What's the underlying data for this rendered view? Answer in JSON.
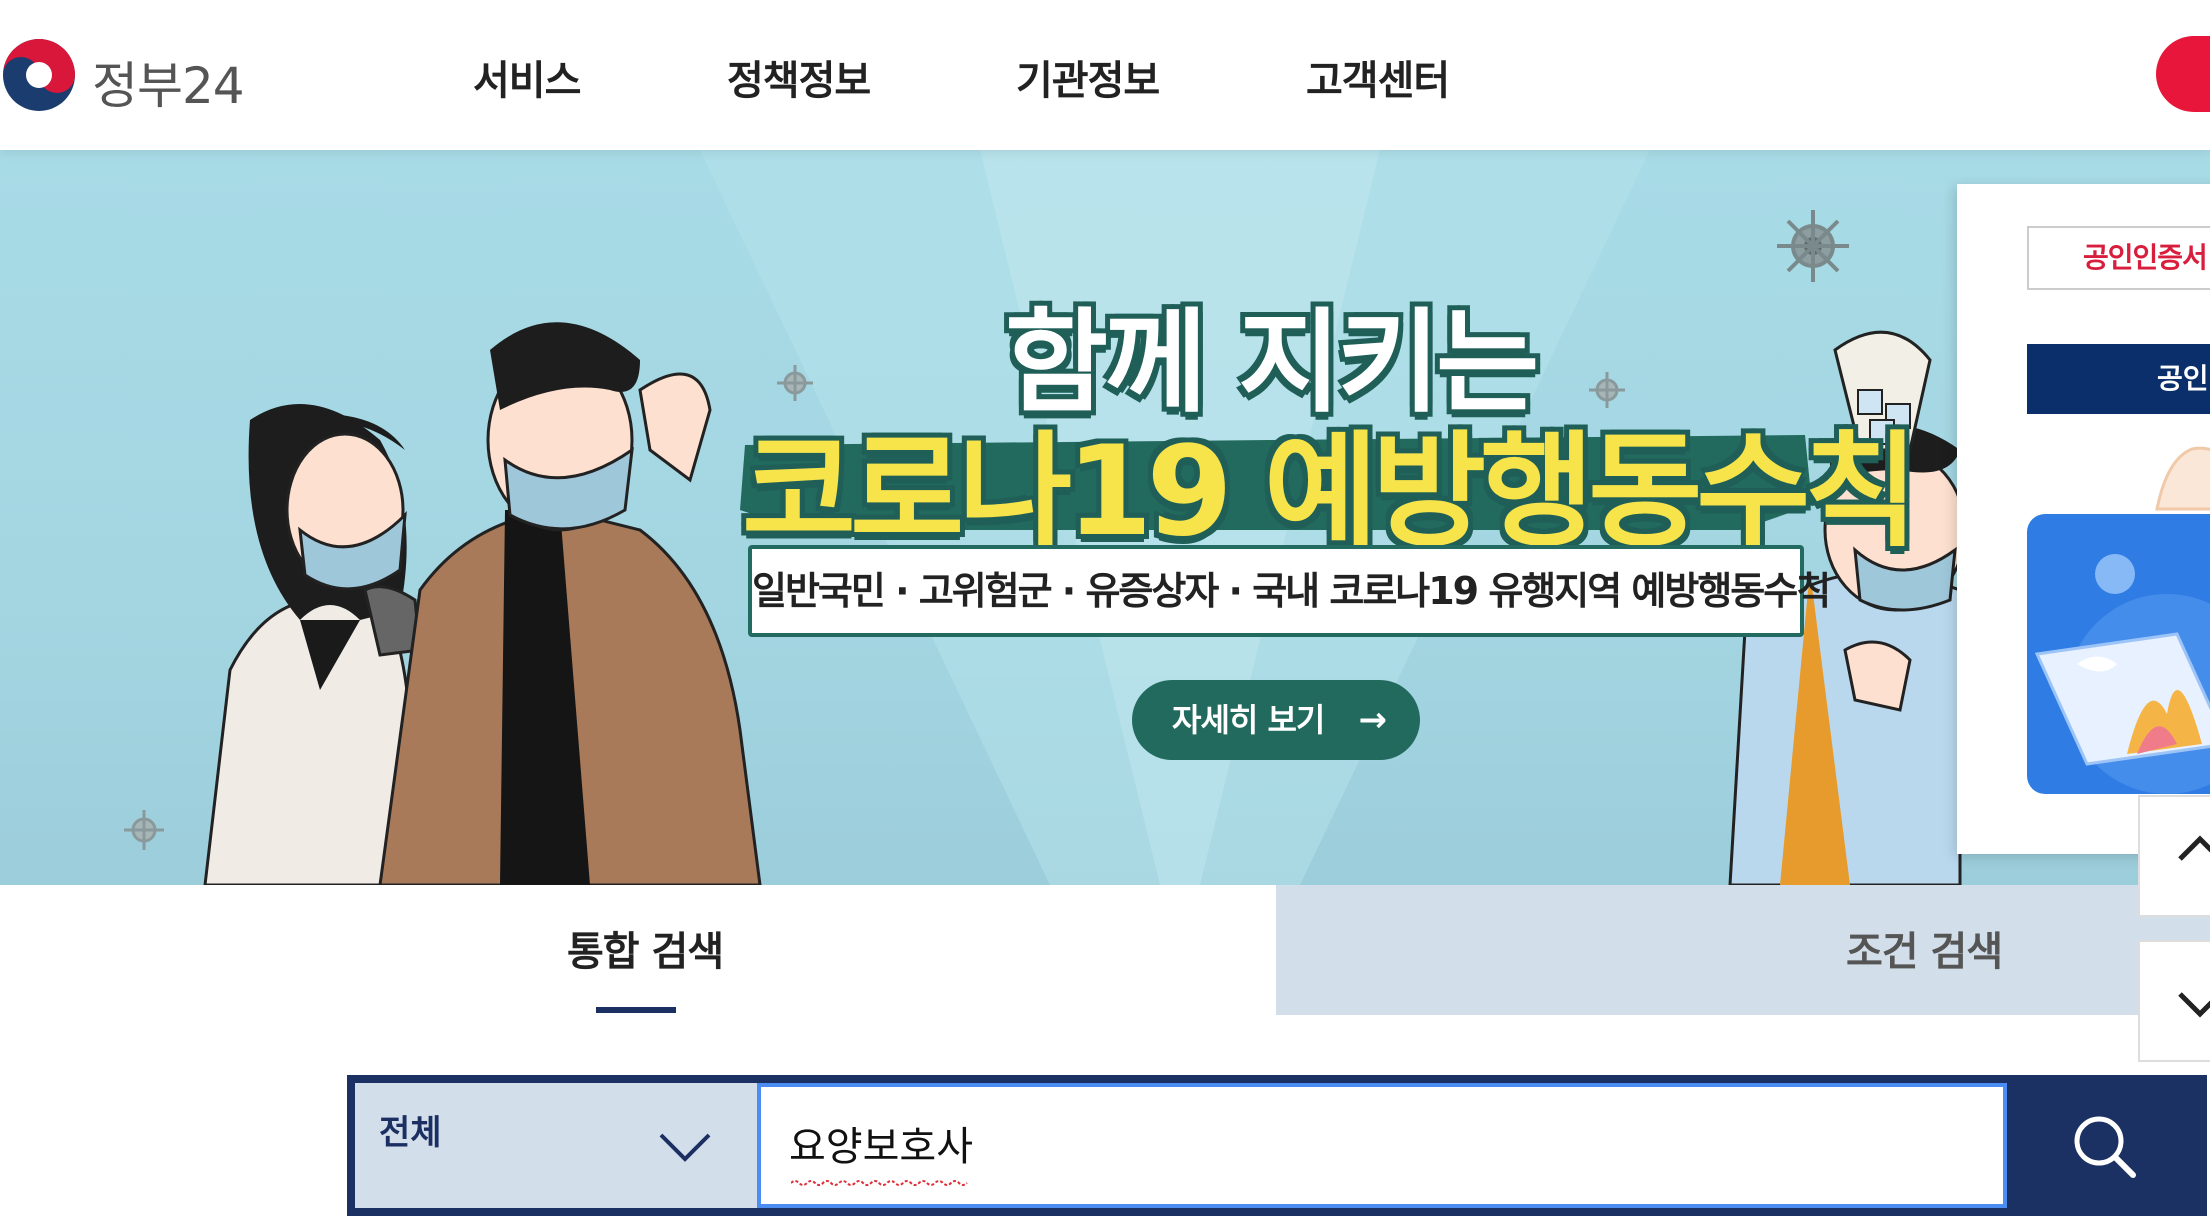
{
  "header": {
    "logo_text": "정부24",
    "nav": [
      "서비스",
      "정책정보",
      "기관정보",
      "고객센터"
    ]
  },
  "banner": {
    "title_line1": "함께 지키는",
    "title_line2": "코로나19 예방행동수칙",
    "subtitle": "일반국민 · 고위험군 · 유증상자 · 국내 코로나19 유행지역 예방행동수칙",
    "button_label": "자세히 보기",
    "button_arrow": "→"
  },
  "side_panel": {
    "cert_outline_label": "공인인증서",
    "cert_solid_label": "공인"
  },
  "search": {
    "tabs": [
      "통합 검색",
      "조건 검색"
    ],
    "active_tab": "통합 검색",
    "category_selected": "전체",
    "query": "요양보호사"
  },
  "colors": {
    "brand_navy": "#1c3163",
    "brand_red": "#e8163a",
    "banner_green": "#226a5d",
    "banner_yellow": "#f7e34a",
    "tab_inactive_bg": "#d2deea",
    "input_focus": "#4b8df3"
  },
  "icons": {
    "logo": "korea-government-emblem",
    "search": "magnifier",
    "select": "chevron-down",
    "scroll_up": "chevron-up",
    "scroll_down": "chevron-down",
    "banner_button": "arrow-right"
  }
}
